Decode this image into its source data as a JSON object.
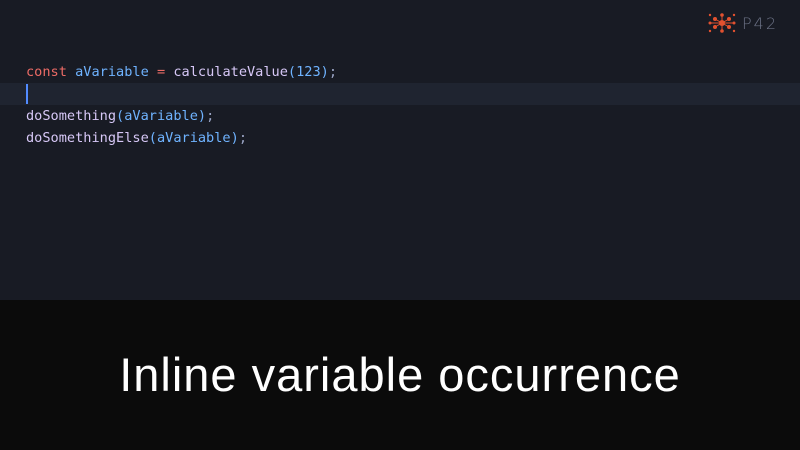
{
  "editor": {
    "lines": [
      {
        "tokens": [
          {
            "text": "const",
            "type": "kw"
          },
          {
            "text": " ",
            "type": "plain"
          },
          {
            "text": "aVariable",
            "type": "var"
          },
          {
            "text": " ",
            "type": "plain"
          },
          {
            "text": "=",
            "type": "kw"
          },
          {
            "text": " ",
            "type": "plain"
          },
          {
            "text": "calculateValue",
            "type": "fn"
          },
          {
            "text": "(",
            "type": "paren"
          },
          {
            "text": "123",
            "type": "num"
          },
          {
            "text": ")",
            "type": "paren"
          },
          {
            "text": ";",
            "type": "punc"
          }
        ]
      },
      {
        "cursor": true,
        "tokens": []
      },
      {
        "tokens": [
          {
            "text": "doSomething",
            "type": "fn"
          },
          {
            "text": "(",
            "type": "paren"
          },
          {
            "text": "aVariable",
            "type": "var"
          },
          {
            "text": ")",
            "type": "paren"
          },
          {
            "text": ";",
            "type": "punc"
          }
        ]
      },
      {
        "tokens": [
          {
            "text": "doSomethingElse",
            "type": "fn"
          },
          {
            "text": "(",
            "type": "paren"
          },
          {
            "text": "aVariable",
            "type": "var"
          },
          {
            "text": ")",
            "type": "paren"
          },
          {
            "text": ";",
            "type": "punc"
          }
        ]
      }
    ]
  },
  "logo": {
    "text": "P42",
    "icon": "p42-logo-icon",
    "color": "#e2512f"
  },
  "caption": {
    "text": "Inline variable occurrence"
  },
  "colors": {
    "editor_bg": "#181b24",
    "caption_bg": "#0b0b0b",
    "keyword": "#ec6b66",
    "variable": "#6fb3ff",
    "function": "#d7c8f7",
    "cursor": "#528bff"
  }
}
